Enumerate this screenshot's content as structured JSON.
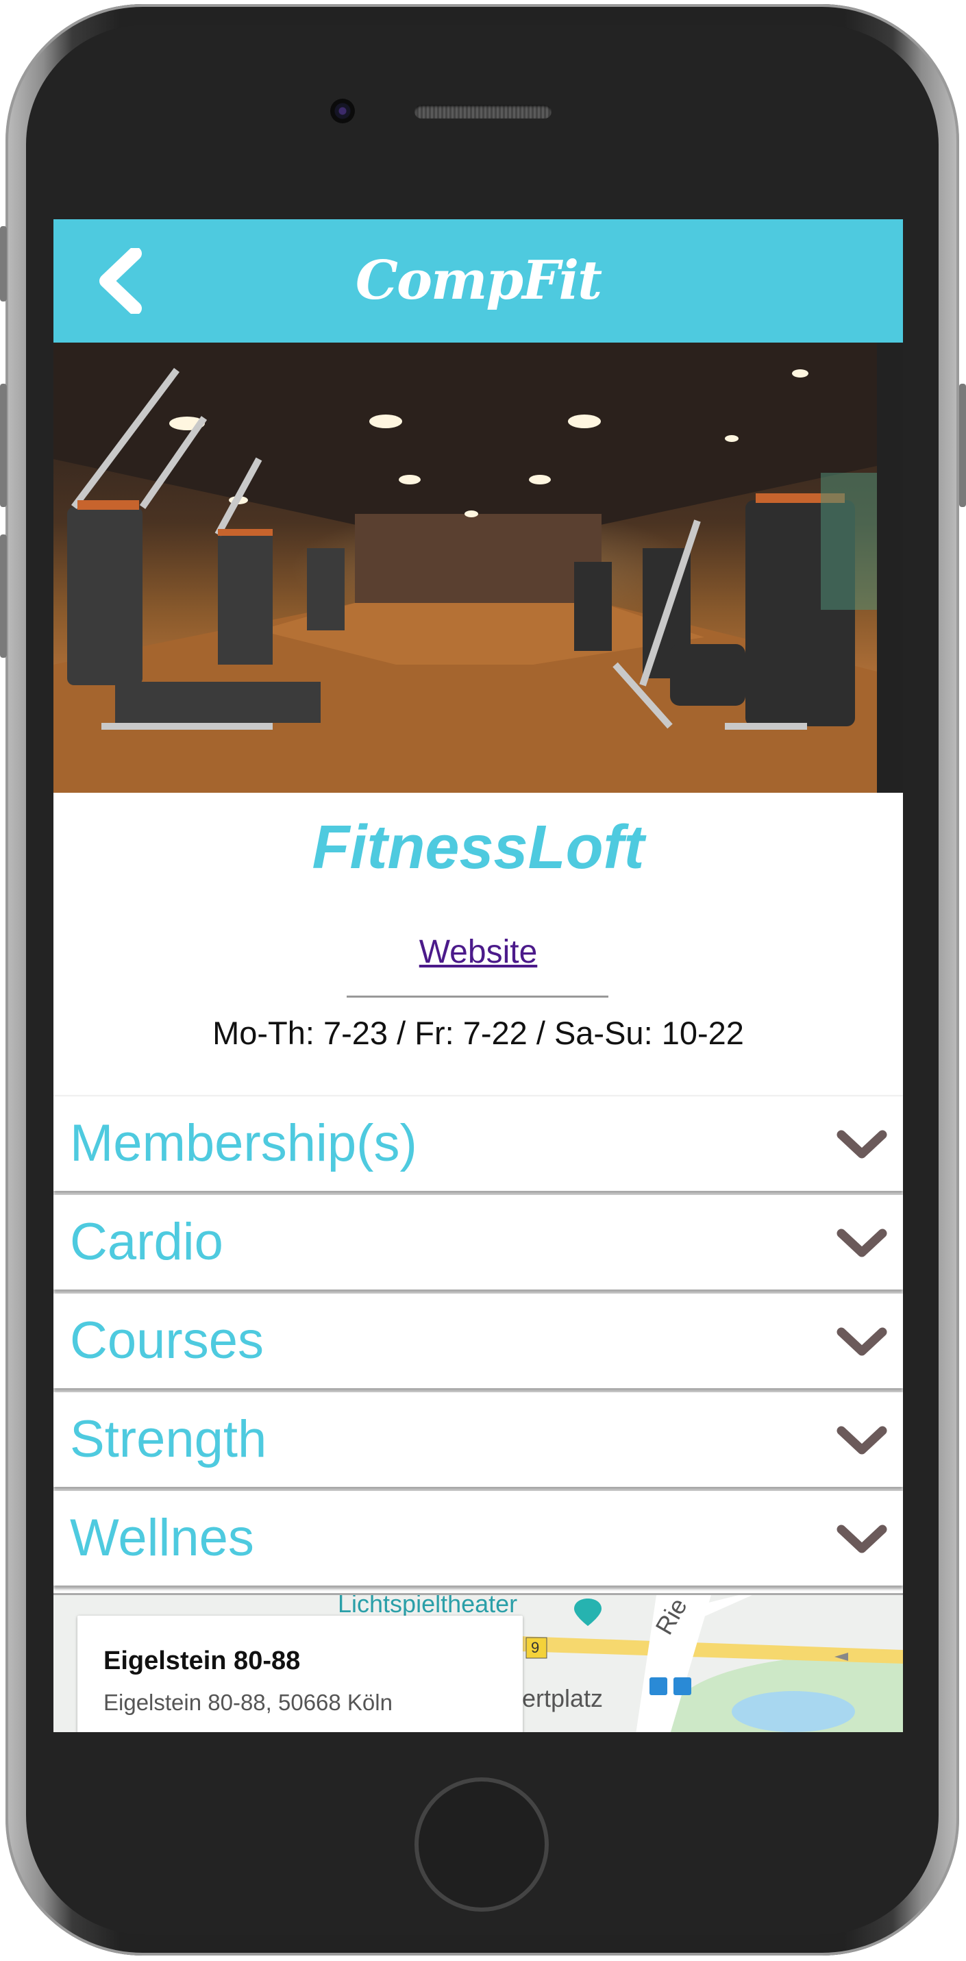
{
  "app": {
    "brand": "CompFit",
    "back_icon": "chevron-left-icon",
    "accent_color": "#4ecadf"
  },
  "gym": {
    "name": "FitnessLoft",
    "website_label": "Website",
    "hours": "Mo-Th: 7-23 / Fr: 7-22 / Sa-Su: 10-22"
  },
  "sections": [
    {
      "label": "Membership(s)",
      "icon": "chevron-down-icon"
    },
    {
      "label": "Cardio",
      "icon": "chevron-down-icon"
    },
    {
      "label": "Courses",
      "icon": "chevron-down-icon"
    },
    {
      "label": "Strength",
      "icon": "chevron-down-icon"
    },
    {
      "label": "Wellnes",
      "icon": "chevron-down-icon"
    }
  ],
  "map": {
    "place_title": "Eigelstein 80-88",
    "place_address": "Eigelstein 80-88, 50668 Köln",
    "labels": {
      "poi": "Lichtspieltheater",
      "road_number": "9",
      "street_partial": "Rie",
      "square_partial": "ertplatz"
    }
  }
}
